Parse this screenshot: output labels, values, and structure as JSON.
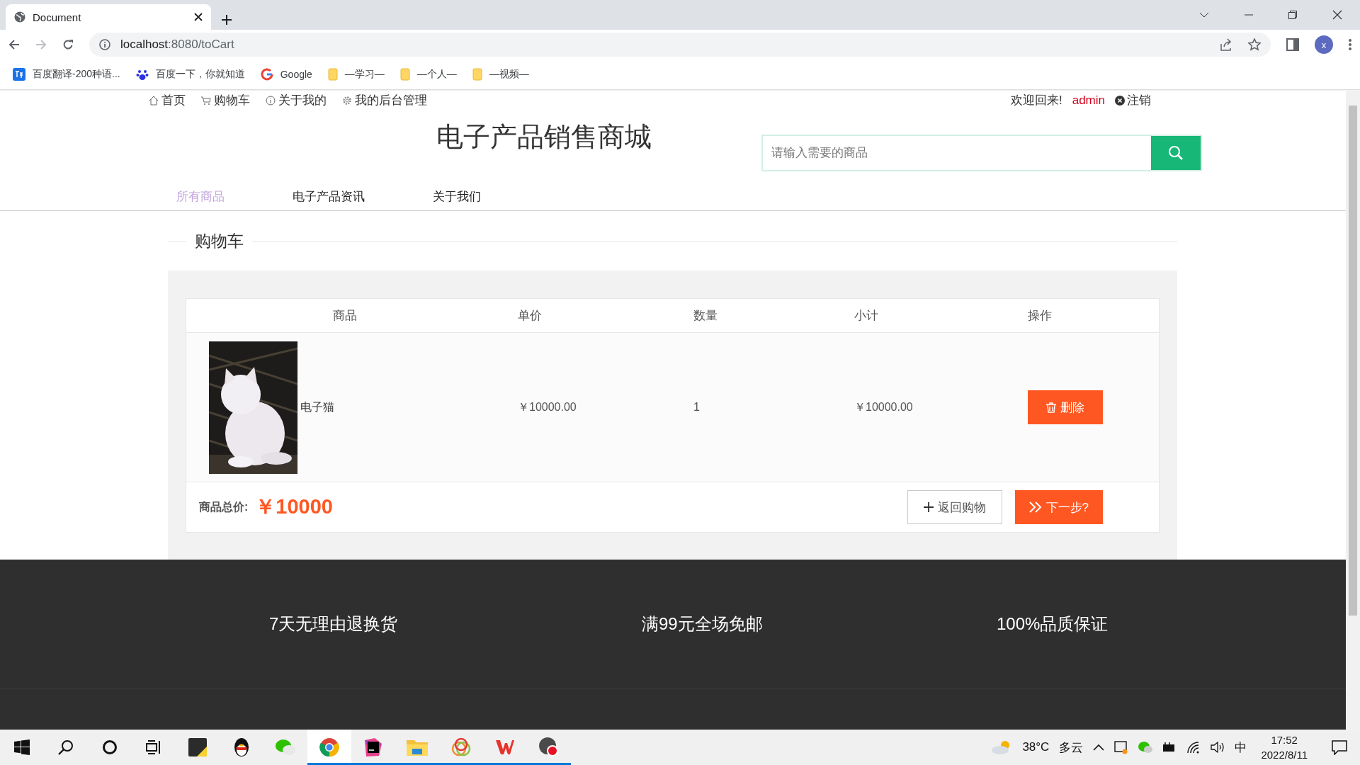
{
  "browser": {
    "tabs": [
      {
        "title": "Document",
        "selected": true
      }
    ],
    "url_host": "localhost",
    "url_rest": ":8080/toCart",
    "profile_initial": "x",
    "bookmarks": [
      {
        "label": "百度翻译-200种语...",
        "kind": "translate"
      },
      {
        "label": "百度一下，你就知道",
        "kind": "paw"
      },
      {
        "label": "Google",
        "kind": "google"
      },
      {
        "label": "—学习—",
        "kind": "folder"
      },
      {
        "label": "—个人—",
        "kind": "folder"
      },
      {
        "label": "—视频—",
        "kind": "folder"
      }
    ]
  },
  "top_links": [
    {
      "label": "首页",
      "kind": "home"
    },
    {
      "label": "购物车",
      "kind": "cart"
    },
    {
      "label": "关于我的",
      "kind": "about"
    },
    {
      "label": "我的后台管理",
      "kind": "admin"
    }
  ],
  "welcome": "欢迎回来!",
  "username": "admin",
  "logout": "注销",
  "site_title": "电子产品销售商城",
  "search": {
    "placeholder": "请输入需要的商品"
  },
  "nav": [
    {
      "label": "所有商品",
      "selected": true
    },
    {
      "label": "电子产品资讯",
      "selected": false
    },
    {
      "label": "关于我们",
      "selected": false
    }
  ],
  "cart": {
    "legend": "购物车",
    "columns": [
      "商品",
      "单价",
      "数量",
      "小计",
      "操作"
    ],
    "rows": [
      {
        "name": "电子猫",
        "price": "￥10000.00",
        "quantity": "1",
        "subtotal": "￥10000.00",
        "action": "删除"
      }
    ],
    "total_label": "商品总价:",
    "total": "￥10000",
    "buttons": [
      {
        "label": "返回购物",
        "kind": "secondary"
      },
      {
        "label": "下一步?",
        "kind": "primary"
      }
    ]
  },
  "footer": {
    "promises": [
      "7天无理由退换货",
      "满99元全场免邮",
      "100%品质保证"
    ]
  },
  "taskbar": {
    "apps": [
      {
        "kind": "sticky",
        "running": false,
        "active": false
      },
      {
        "kind": "penguin",
        "running": false,
        "active": false
      },
      {
        "kind": "chat",
        "running": false,
        "active": false
      },
      {
        "kind": "chrome",
        "running": true,
        "active": true
      },
      {
        "kind": "ide",
        "running": true,
        "active": false
      },
      {
        "kind": "folder",
        "running": true,
        "active": false
      },
      {
        "kind": "rings",
        "running": true,
        "active": false
      },
      {
        "kind": "wps",
        "running": true,
        "active": false
      },
      {
        "kind": "recorder",
        "running": true,
        "active": false
      }
    ],
    "temperature": "38°C",
    "weather": "多云",
    "ime": "中",
    "time": "17:52",
    "date": "2022/8/11"
  }
}
